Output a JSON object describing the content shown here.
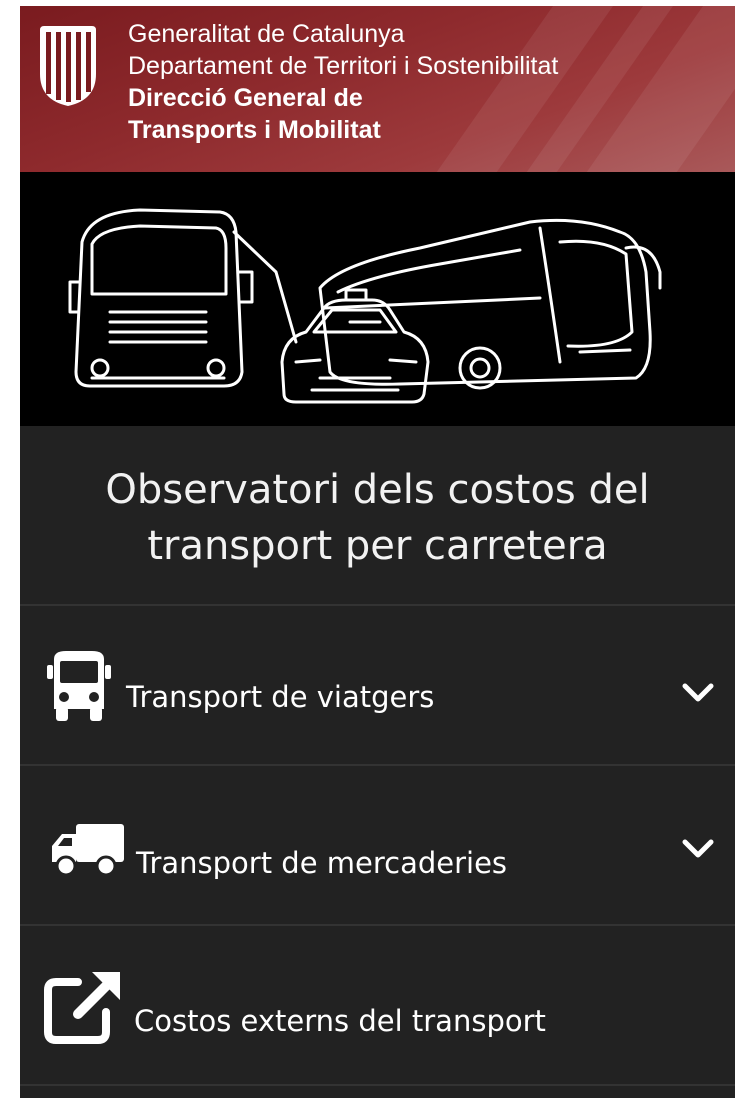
{
  "header": {
    "line1": "Generalitat de Catalunya",
    "line2": "Departament de Territori i Sostenibilitat",
    "line3": "Direcció General de",
    "line4": "Transports i Mobilitat",
    "logo_icon": "catalan-flag-shield-icon"
  },
  "hero": {
    "image": "truck-car-bus-illustration"
  },
  "page": {
    "title_line1": "Observatori dels costos del",
    "title_line2": "transport per carretera"
  },
  "menu": {
    "items": [
      {
        "label": "Transport de viatgers",
        "icon": "bus-icon",
        "expand_icon": "chevron-down-icon"
      },
      {
        "label": "Transport de mercaderies",
        "icon": "truck-icon",
        "expand_icon": "chevron-down-icon"
      },
      {
        "label": "Costos externs del transport",
        "icon": "external-link-icon"
      }
    ]
  },
  "colors": {
    "banner": "#8e2a2d",
    "background": "#222222",
    "hero_background": "#000000",
    "text": "#ffffff"
  }
}
